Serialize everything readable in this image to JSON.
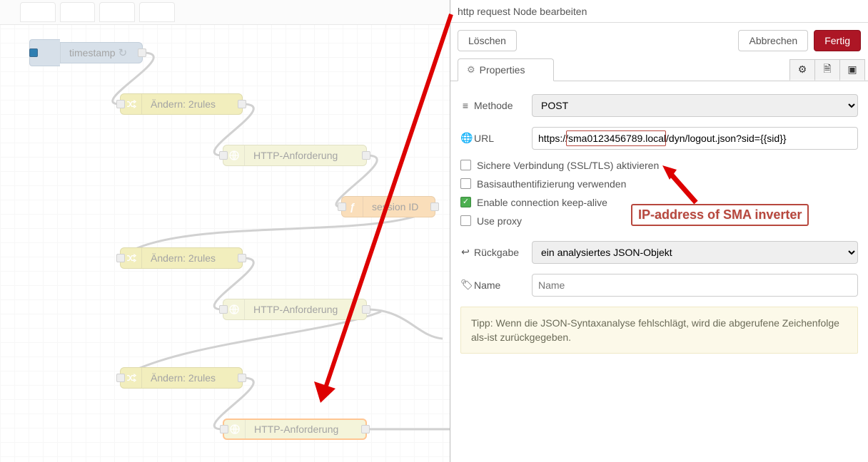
{
  "tabs": [
    "",
    "",
    "",
    ""
  ],
  "nodes": {
    "inject_label": "timestamp",
    "change1_label": "Ändern: 2rules",
    "http1_label": "HTTP-Anforderung",
    "func_label": "session ID",
    "change2_label": "Ändern: 2rules",
    "http2_label": "HTTP-Anforderung",
    "change3_label": "Ändern: 2rules",
    "http3_label": "HTTP-Anforderung"
  },
  "panel": {
    "title": "http request Node bearbeiten",
    "delete": "Löschen",
    "cancel": "Abbrechen",
    "done": "Fertig",
    "properties_tab": "Properties",
    "labels": {
      "method": "Methode",
      "url": "URL",
      "return": "Rückgabe",
      "name": "Name"
    },
    "method_value": "POST",
    "url_value": "https://sma0123456789.local/dyn/logout.json?sid={{sid}}",
    "url_highlight_text": "sma0123456789.local",
    "checkboxes": {
      "tls": "Sichere Verbindung (SSL/TLS) aktivieren",
      "basicauth": "Basisauthentifizierung verwenden",
      "keepalive": "Enable connection keep-alive",
      "proxy": "Use proxy"
    },
    "return_value": "ein analysiertes JSON-Objekt",
    "name_placeholder": "Name",
    "tip": "Tipp: Wenn die JSON-Syntaxanalyse fehlschlägt, wird die abgerufene Zeichenfolge als-ist zurückgegeben."
  },
  "annotation": {
    "label": "IP-address of SMA inverter"
  }
}
